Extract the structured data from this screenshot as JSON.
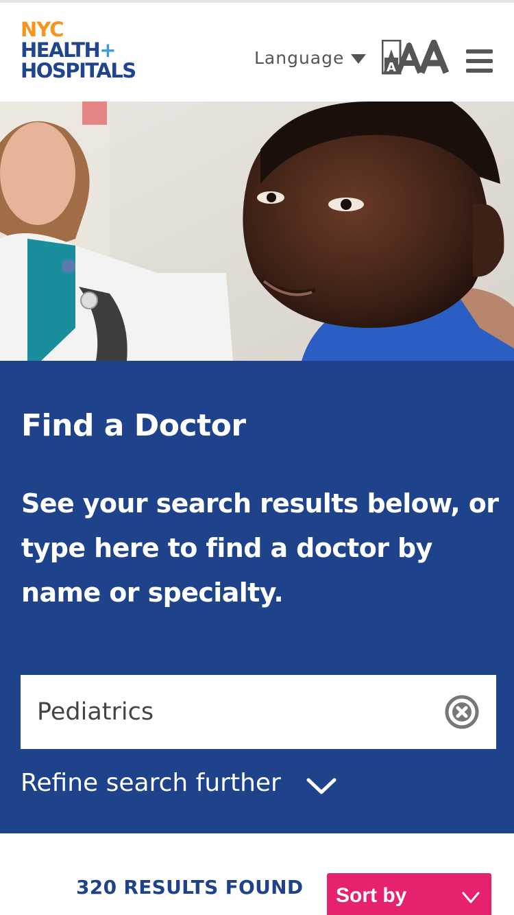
{
  "header": {
    "logo": {
      "line1": "NYC",
      "line2": "HEALTH",
      "plus": "+",
      "line3": "HOSPITALS"
    },
    "language_label": "Language",
    "text_size_icon": "text-size-icon",
    "menu_icon": "hamburger-menu-icon"
  },
  "hero": {
    "image": "doctor-with-child-photo"
  },
  "panel": {
    "title": "Find a Doctor",
    "intro": "See your search results below, or type here to find a doctor by name or specialty.",
    "search": {
      "value": "Pediatrics",
      "clear_icon": "clear-circle-icon"
    },
    "refine_label": "Refine search further"
  },
  "results": {
    "count_text": "320 RESULTS FOUND",
    "sort_label": "Sort by"
  },
  "colors": {
    "brand_blue": "#1f438b",
    "brand_orange": "#f7941d",
    "accent_pink": "#e6226f"
  }
}
